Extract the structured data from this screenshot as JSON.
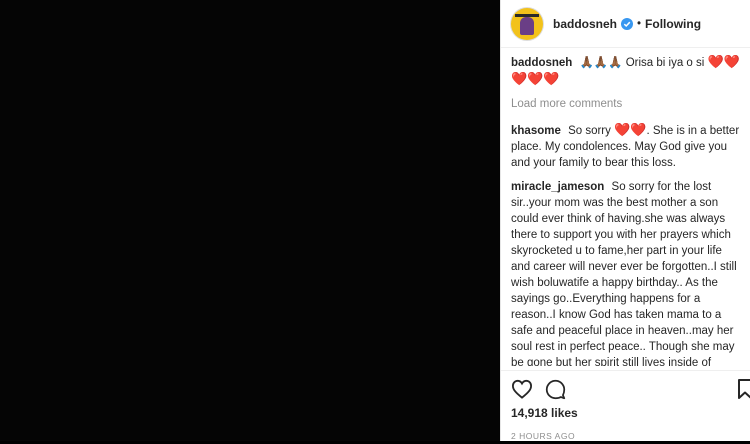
{
  "post": {
    "username": "baddosneh",
    "separator": "•",
    "follow_label": "Following",
    "caption_user": "baddosneh",
    "caption_text": "🙏🏾🙏🏾🙏🏾 Orisa bi iya o si",
    "caption_hearts": "❤️❤️❤️❤️❤️",
    "load_more": "Load more comments",
    "comments": [
      {
        "user": "khasome",
        "pre": "So sorry",
        "hearts": "❤️❤️",
        "text": ". She is in a better place. My condolences. May God give you and your family to bear this loss."
      },
      {
        "user": "miracle_jameson",
        "text": "So sorry for the lost sir..your mom was the best mother a son could ever think of having.she was always there to support you with her prayers which skyrocketed u to fame,her part in your life and career will never ever be forgotten..I still wish boluwatife a happy birthday.. As the sayings go..Everything happens for a reason..I know God has taken mama to a safe and peaceful place in heaven..may her soul rest in perfect peace.. Though she may be gone but her spirit still lives inside of all..mummy was a legend.."
      }
    ],
    "likes": "14,918 likes",
    "time": "2 HOURS AGO"
  },
  "icons": {
    "like": "heart-outline-icon",
    "comment": "comment-bubble-icon",
    "save": "bookmark-icon",
    "verified": "verified-badge-icon"
  },
  "colors": {
    "media_bg": "#050505",
    "verified": "#3897f0",
    "heart": "#d40a1e",
    "muted": "#8e8e8e"
  }
}
